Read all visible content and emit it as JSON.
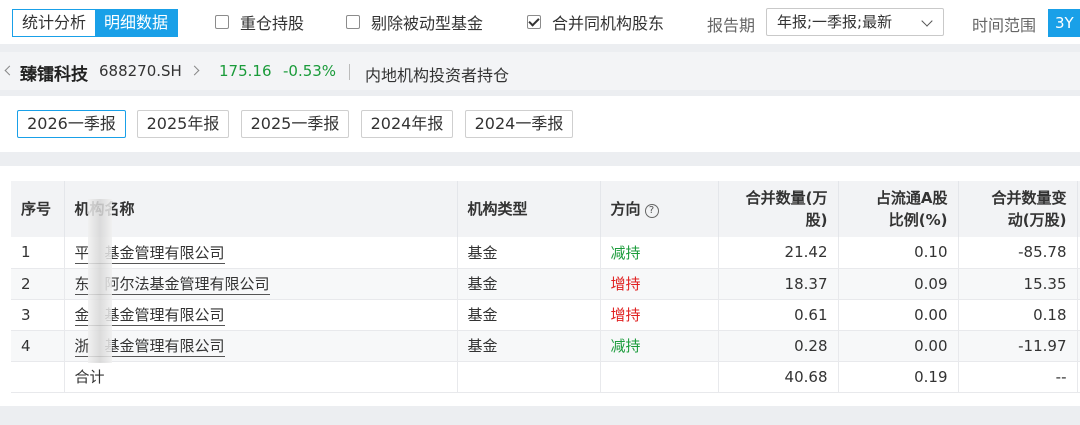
{
  "toolbar": {
    "tabs": [
      {
        "label": "统计分析",
        "active": false
      },
      {
        "label": "明细数据",
        "active": true
      }
    ],
    "checkboxes": [
      {
        "label": "重仓持股",
        "checked": false
      },
      {
        "label": "剔除被动型基金",
        "checked": false
      },
      {
        "label": "合并同机构股东",
        "checked": true
      }
    ],
    "period_label": "报告期",
    "period_value": "年报;一季报;最新",
    "range_label": "时间范围",
    "range_value": "3Y"
  },
  "stock": {
    "name": "臻镭科技",
    "code": "688270.SH",
    "price": "175.16",
    "change": "-0.53%",
    "title": "内地机构投资者持仓",
    "change_color": "#1a9b3a"
  },
  "periods": [
    {
      "label": "2026一季报",
      "active": true
    },
    {
      "label": "2025年报",
      "active": false
    },
    {
      "label": "2025一季报",
      "active": false
    },
    {
      "label": "2024年报",
      "active": false
    },
    {
      "label": "2024一季报",
      "active": false
    }
  ],
  "table": {
    "headers": {
      "index": "序号",
      "name": "机构名称",
      "type": "机构类型",
      "direction": "方向",
      "qty_line1": "合并数量(万",
      "qty_line2": "股)",
      "ratio_line1": "占流通A股",
      "ratio_line2": "比例(%)",
      "change_line1": "合并数量变",
      "change_line2": "动(万股)"
    },
    "rows": [
      {
        "index": "1",
        "name": "平　基金管理有限公司",
        "type": "基金",
        "direction": "减持",
        "qty": "21.42",
        "ratio": "0.10",
        "change": "-85.78"
      },
      {
        "index": "2",
        "name": "东　阿尔法基金管理有限公司",
        "type": "基金",
        "direction": "增持",
        "qty": "18.37",
        "ratio": "0.09",
        "change": "15.35"
      },
      {
        "index": "3",
        "name": "金　基金管理有限公司",
        "type": "基金",
        "direction": "增持",
        "qty": "0.61",
        "ratio": "0.00",
        "change": "0.18"
      },
      {
        "index": "4",
        "name": "浙　基金管理有限公司",
        "type": "基金",
        "direction": "减持",
        "qty": "0.28",
        "ratio": "0.00",
        "change": "-11.97"
      }
    ],
    "total": {
      "label": "合计",
      "qty": "40.68",
      "ratio": "0.19",
      "change": "--"
    },
    "colors": {
      "increase": "#e02020",
      "decrease": "#1a9b3a",
      "accent": "#19a0e8"
    }
  }
}
